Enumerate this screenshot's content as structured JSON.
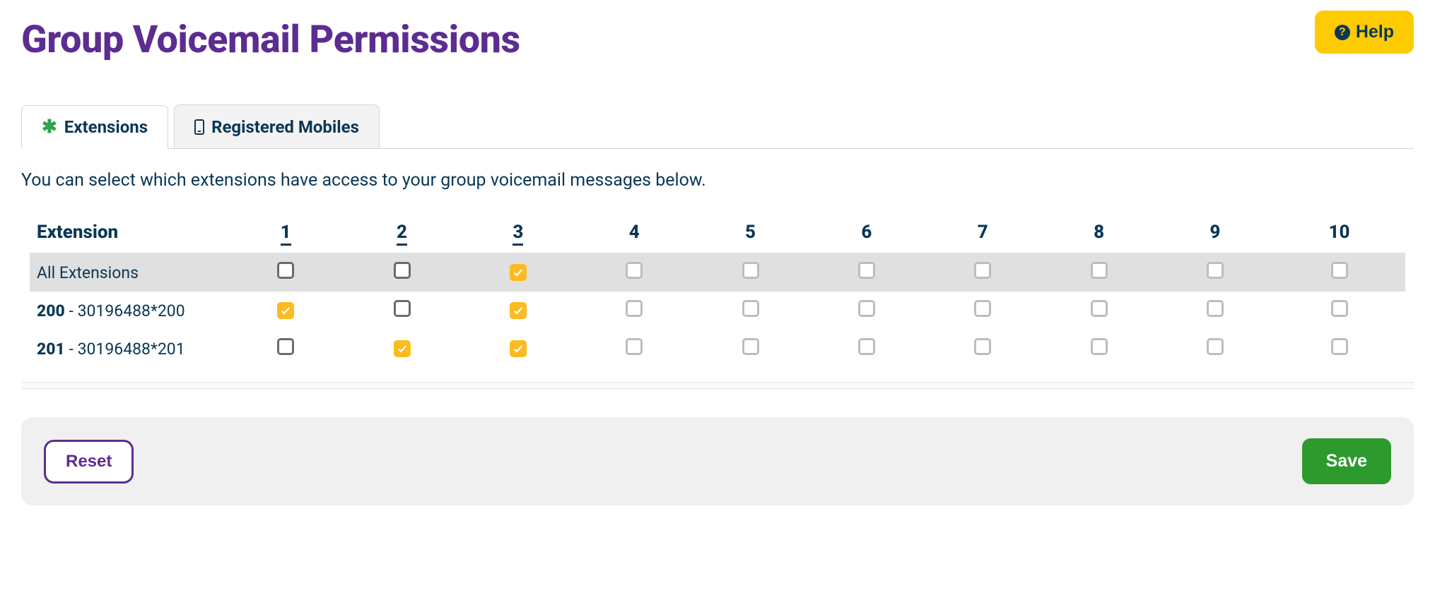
{
  "header": {
    "title": "Group Voicemail Permissions",
    "help_label": "Help"
  },
  "tabs": {
    "extensions": "Extensions",
    "registered_mobiles": "Registered Mobiles"
  },
  "description": "You can select which extensions have access to your group voicemail messages below.",
  "table": {
    "col_extension": "Extension",
    "columns": [
      "1",
      "2",
      "3",
      "4",
      "5",
      "6",
      "7",
      "8",
      "9",
      "10"
    ],
    "underlined_cols": [
      0,
      1,
      2
    ],
    "rows": [
      {
        "type": "all",
        "label": "All Extensions",
        "checked": [
          false,
          false,
          true,
          false,
          false,
          false,
          false,
          false,
          false,
          false
        ],
        "active_cols": [
          0,
          1,
          2
        ]
      },
      {
        "type": "ext",
        "ext_num": "200",
        "ext_full": "30196488*200",
        "checked": [
          true,
          false,
          true,
          false,
          false,
          false,
          false,
          false,
          false,
          false
        ],
        "active_cols": [
          0,
          1,
          2
        ]
      },
      {
        "type": "ext",
        "ext_num": "201",
        "ext_full": "30196488*201",
        "checked": [
          false,
          true,
          true,
          false,
          false,
          false,
          false,
          false,
          false,
          false
        ],
        "active_cols": [
          0,
          1,
          2
        ]
      }
    ]
  },
  "footer": {
    "reset": "Reset",
    "save": "Save"
  }
}
